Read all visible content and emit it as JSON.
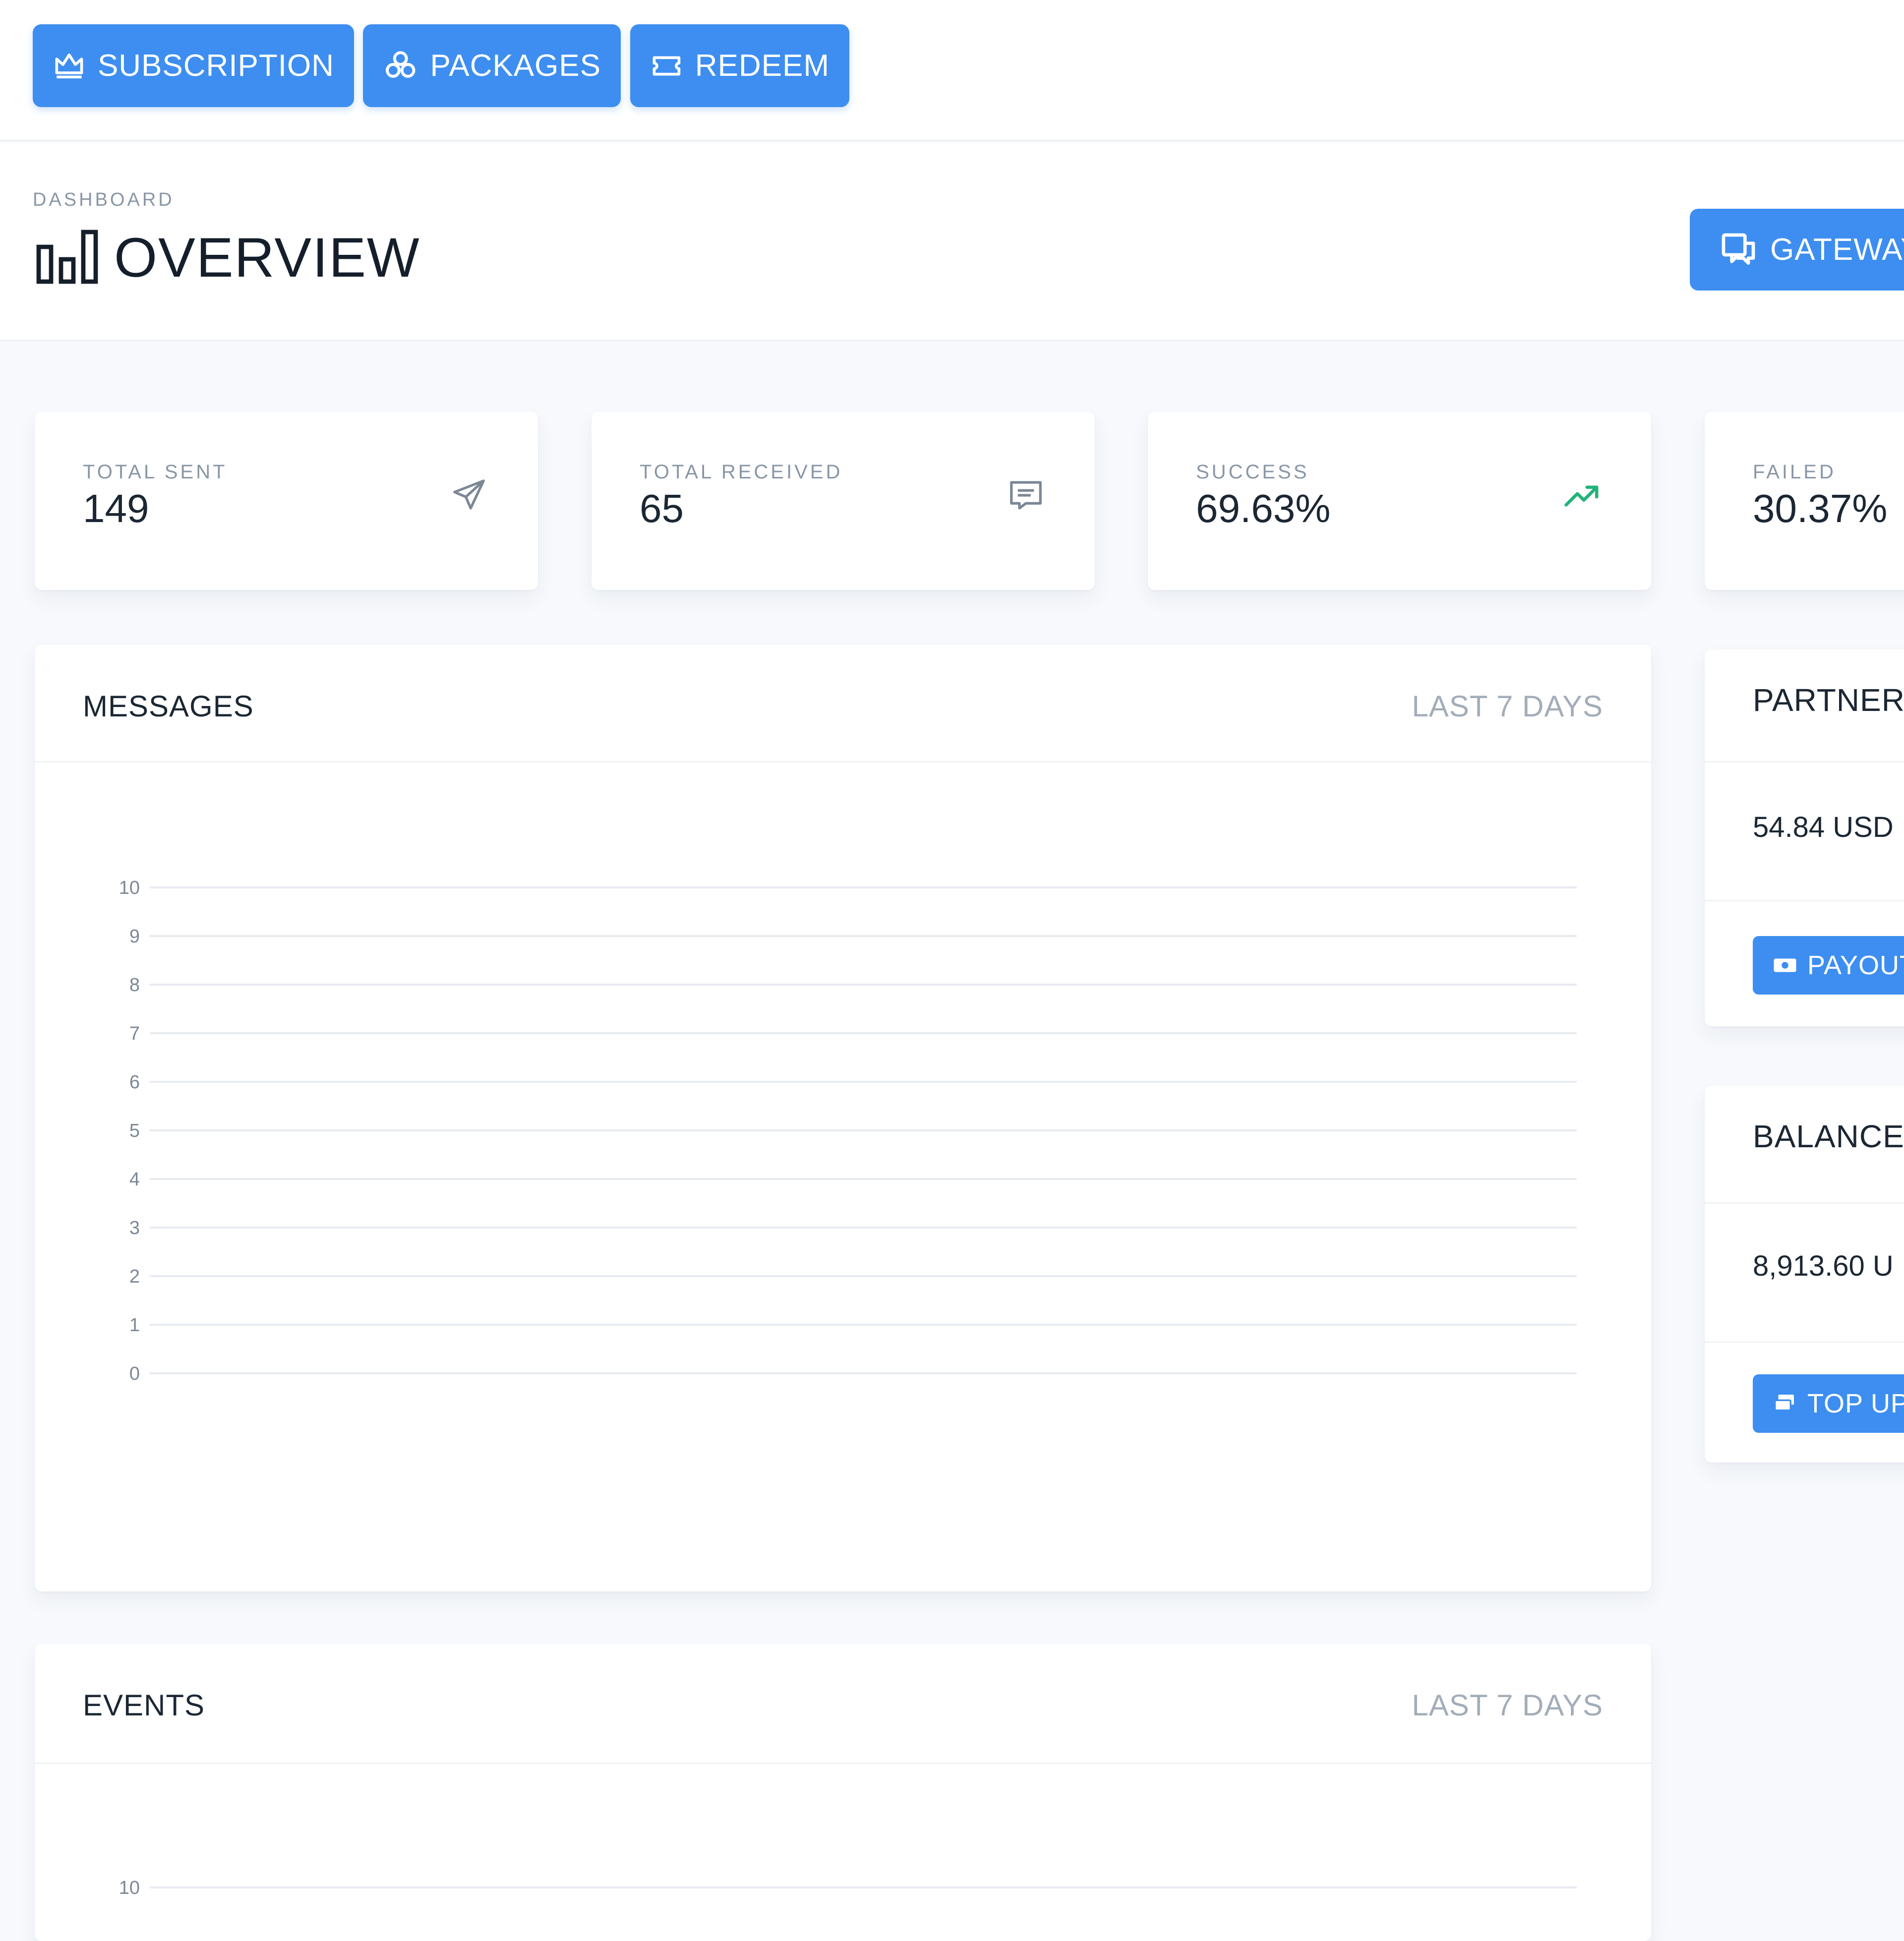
{
  "toolbar": {
    "subscription_label": "SUBSCRIPTION",
    "packages_label": "PACKAGES",
    "redeem_label": "REDEEM"
  },
  "header": {
    "breadcrumb": "DASHBOARD",
    "title": "OVERVIEW",
    "gateway_label": "GATEWAY"
  },
  "stats": [
    {
      "label": "TOTAL SENT",
      "value": "149",
      "icon": "paper-plane-icon"
    },
    {
      "label": "TOTAL RECEIVED",
      "value": "65",
      "icon": "message-icon"
    },
    {
      "label": "SUCCESS",
      "value": "69.63%",
      "icon": "trend-up-icon",
      "icon_color": "#22b37a"
    },
    {
      "label": "FAILED",
      "value": "30.37%"
    }
  ],
  "messages_panel": {
    "title": "MESSAGES",
    "range": "LAST 7 DAYS"
  },
  "events_panel": {
    "title": "EVENTS",
    "range": "LAST 7 DAYS"
  },
  "partners": {
    "title": "PARTNERS",
    "value": "54.84 USD",
    "button_label": "PAYOUT"
  },
  "balance": {
    "title": "BALANCE",
    "value": "8,913.60 U",
    "button_label": "TOP UP"
  },
  "colors": {
    "accent": "#3d8ef0",
    "success": "#22b37a"
  },
  "chart_data": [
    {
      "type": "line",
      "title": "MESSAGES",
      "ylim": [
        0,
        10
      ],
      "yticks": [
        "0",
        "1",
        "2",
        "3",
        "4",
        "5",
        "6",
        "7",
        "8",
        "9",
        "10"
      ],
      "grid": true,
      "series": []
    },
    {
      "type": "line",
      "title": "EVENTS",
      "yticks": [
        "10"
      ],
      "grid": true,
      "series": []
    }
  ]
}
